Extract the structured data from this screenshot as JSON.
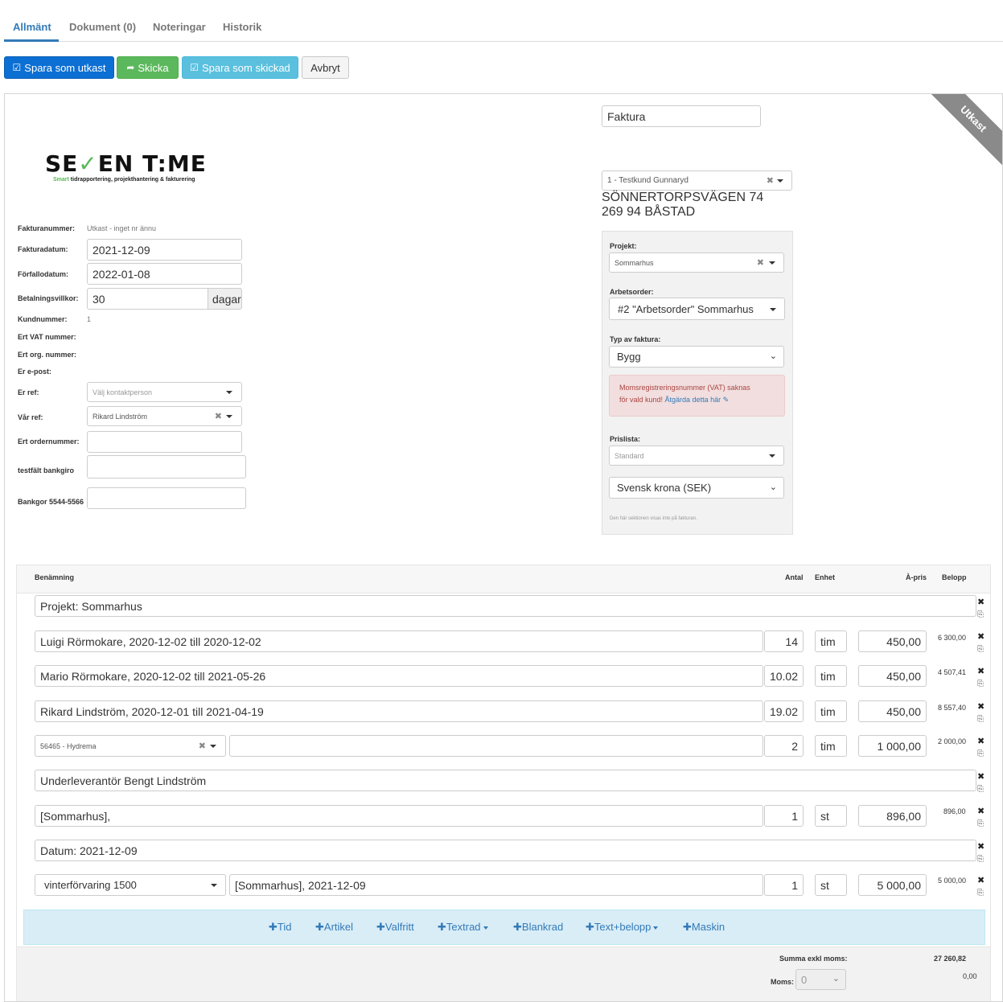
{
  "tabs": [
    {
      "label": "Allmänt",
      "active": true
    },
    {
      "label": "Dokument (0)"
    },
    {
      "label": "Noteringar"
    },
    {
      "label": "Historik"
    }
  ],
  "toolbar": {
    "save_draft": "Spara som utkast",
    "send": "Skicka",
    "save_sent": "Spara som skickad",
    "cancel": "Avbryt"
  },
  "ribbon": "Utkast",
  "logo": {
    "text_before": "SE",
    "text_after": "EN T",
    "text_end": "ME",
    "tick": "✓",
    "colon": ":",
    "sub_green": "Smart",
    "sub_rest": " tidrapportering, projekthantering & fakturering"
  },
  "document_type": "Faktura",
  "customer": {
    "select": "1 - Testkund Gunnaryd",
    "address_line1": "SÖNNERTORPSVÄGEN 74",
    "address_line2": "269 94 BÅSTAD"
  },
  "form": {
    "invoice_number_label": "Fakturanummer:",
    "invoice_number_value": "Utkast - inget nr ännu",
    "invoice_date_label": "Fakturadatum:",
    "invoice_date": "2021-12-09",
    "due_date_label": "Förfallodatum:",
    "due_date": "2022-01-08",
    "payment_terms_label": "Betalningsvillkor:",
    "payment_terms": "30",
    "payment_terms_unit": "dagar",
    "customer_number_label": "Kundnummer:",
    "customer_number": "1",
    "vat_label": "Ert VAT nummer:",
    "org_label": "Ert org. nummer:",
    "email_label": "Er e-post:",
    "your_ref_label": "Er ref:",
    "your_ref_placeholder": "Välj kontaktperson",
    "our_ref_label": "Vår ref:",
    "our_ref": "Rikard Lindström",
    "order_number_label": "Ert ordernummer:",
    "bankgiro_label": "testfält bankgiro",
    "bankgor_label": "Bankgor 5544-5566"
  },
  "side": {
    "project_label": "Projekt:",
    "project": "Sommarhus",
    "work_order_label": "Arbetsorder:",
    "work_order": "#2 \"Arbetsorder\" Sommarhus",
    "invoice_type_label": "Typ av faktura:",
    "invoice_type": "Bygg",
    "alert_line1": "Momsregistreringsnummer (VAT) saknas",
    "alert_line2": "för vald kund! ",
    "alert_link": "Åtgärda detta här",
    "pricelist_label": "Prislista:",
    "pricelist": "Standard",
    "currency": "Svensk krona (SEK)",
    "note": "Den här sektionen visas inte på fakturan."
  },
  "lines": {
    "headers": {
      "name": "Benämning",
      "qty": "Antal",
      "unit": "Enhet",
      "price": "À-pris",
      "amount": "Belopp"
    },
    "rows": [
      {
        "text": "Projekt: Sommarhus"
      },
      {
        "text": "Luigi Rörmokare, 2020-12-02 till 2020-12-02",
        "qty": "14",
        "unit": "tim",
        "price": "450,00",
        "amount": "6 300,00"
      },
      {
        "text": "Mario Rörmokare, 2020-12-02 till 2021-05-26",
        "qty": "10.02",
        "unit": "tim",
        "price": "450,00",
        "amount": "4 507,41"
      },
      {
        "text": "Rikard Lindström, 2020-12-01 till 2021-04-19",
        "qty": "19.02",
        "unit": "tim",
        "price": "450,00",
        "amount": "8 557,40"
      },
      {
        "select": "56465 - Hydrema",
        "text": "",
        "qty": "2",
        "unit": "tim",
        "price": "1 000,00",
        "amount": "2 000,00"
      },
      {
        "text": "Underleverantör Bengt Lindström"
      },
      {
        "text": "[Sommarhus],",
        "qty": "1",
        "unit": "st",
        "price": "896,00",
        "amount": "896,00"
      },
      {
        "text": "Datum: 2021-12-09"
      },
      {
        "select": "vinterförvaring 1500",
        "text": "[Sommarhus], 2021-12-09",
        "qty": "1",
        "unit": "st",
        "price": "5 000,00",
        "amount": "5 000,00"
      }
    ],
    "add_buttons": [
      "Tid",
      "Artikel",
      "Valfritt",
      "Textrad",
      "Blankrad",
      "Text+belopp",
      "Maskin"
    ],
    "sum_label": "Summa exkl moms:",
    "sum_value": "27 260,82",
    "vat_label": "Moms:",
    "vat_select": "0",
    "vat_value": "0,00"
  }
}
